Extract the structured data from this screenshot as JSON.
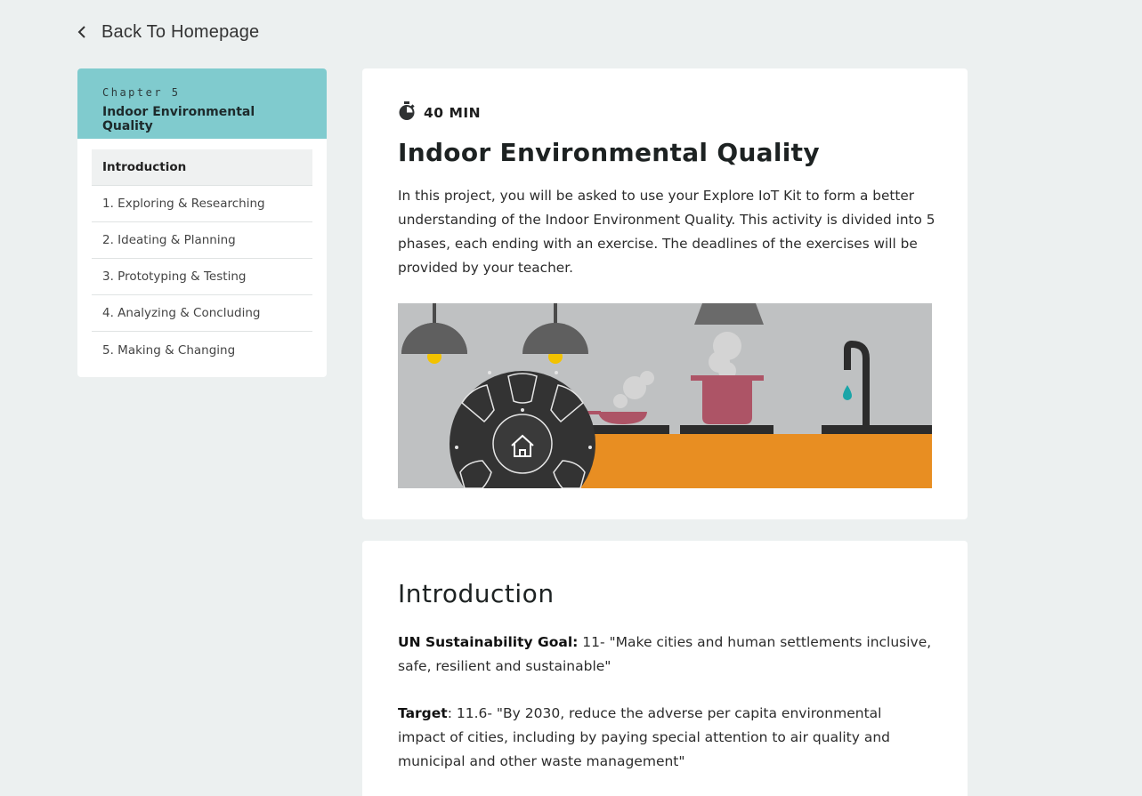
{
  "back": {
    "label": "Back To Homepage",
    "icon": "chevron-left-icon"
  },
  "chapter": {
    "number": "Chapter 5",
    "title": "Indoor Environmental Quality",
    "header_color": "#80cbce"
  },
  "nav": {
    "items": [
      {
        "label": "Introduction",
        "active": true
      },
      {
        "label": "1. Exploring & Researching",
        "active": false
      },
      {
        "label": "2. Ideating & Planning",
        "active": false
      },
      {
        "label": "3. Prototyping & Testing",
        "active": false
      },
      {
        "label": "4. Analyzing & Concluding",
        "active": false
      },
      {
        "label": "5. Making & Changing",
        "active": false
      }
    ]
  },
  "lesson": {
    "duration": "40 MIN",
    "duration_icon": "stopwatch-icon",
    "title": "Indoor Environmental Quality",
    "description": "In this project, you will be asked to use your Explore IoT Kit to form a better understanding of the Indoor Environment Quality. This activity is divided into 5 phases, each ending with an exercise. The deadlines of the exercises will be provided by your teacher.",
    "hero_icon": "kitchen-illustration",
    "hero_colors": {
      "wall": "#bfc1c2",
      "counter": "#e88e22",
      "pot": "#ad5466",
      "device": "#333333",
      "water": "#1aa5a8"
    }
  },
  "introduction": {
    "heading": "Introduction",
    "goal_label": "UN Sustainability Goal:",
    "goal_text": " 11- \"Make cities and human settlements inclusive, safe, resilient and sustainable\"",
    "target_label": "Target",
    "target_text": ": 11.6- \"By 2030, reduce the adverse per capita environmental impact of cities, including by paying special attention to air quality and municipal and other waste management\""
  }
}
